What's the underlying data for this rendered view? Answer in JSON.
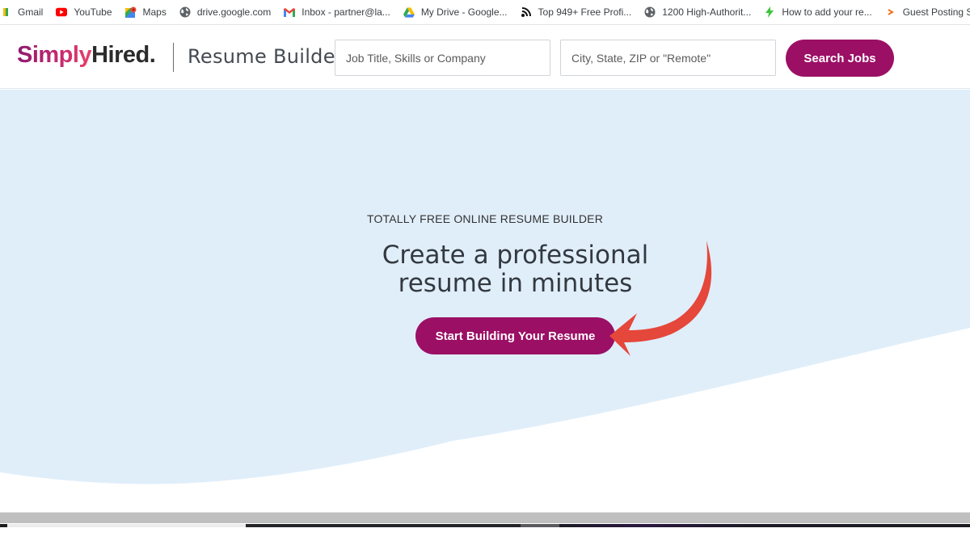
{
  "bookmarks": [
    {
      "label": "Gmail",
      "icon": "gmail-icon"
    },
    {
      "label": "YouTube",
      "icon": "youtube-icon"
    },
    {
      "label": "Maps",
      "icon": "maps-icon"
    },
    {
      "label": "drive.google.com",
      "icon": "globe-icon"
    },
    {
      "label": "Inbox - partner@la...",
      "icon": "gmail-icon"
    },
    {
      "label": "My Drive - Google...",
      "icon": "google-drive-icon"
    },
    {
      "label": "Top 949+ Free Profi...",
      "icon": "rss-icon"
    },
    {
      "label": "1200 High-Authorit...",
      "icon": "globe-icon"
    },
    {
      "label": "How to add your re...",
      "icon": "lightning-icon"
    },
    {
      "label": "Guest Posting Site",
      "icon": "arrow-icon"
    }
  ],
  "header": {
    "logo_part1": "Simply",
    "logo_part2": "Hired.",
    "product": "Resume Builder",
    "job_search_placeholder": "Job Title, Skills or Company",
    "location_placeholder": "City, State, ZIP or \"Remote\"",
    "search_label": "Search Jobs"
  },
  "hero": {
    "eyebrow": "TOTALLY FREE ONLINE RESUME BUILDER",
    "headline_line1": "Create a professional",
    "headline_line2": "resume in minutes",
    "cta_label": "Start Building Your Resume"
  },
  "colors": {
    "brand": "#9b0f65",
    "hero_bg": "#e0eefa",
    "annotation_arrow": "#e5473b"
  }
}
